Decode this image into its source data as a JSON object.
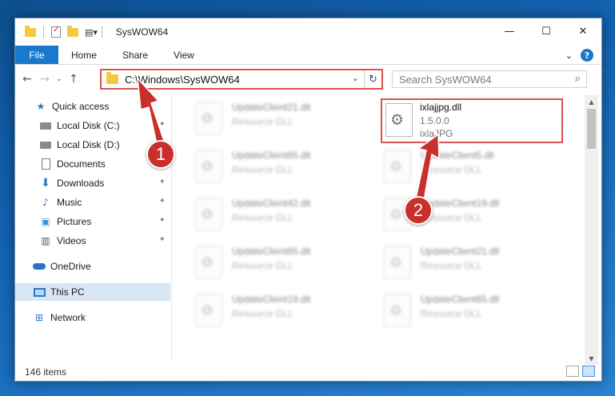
{
  "window": {
    "title": "SysWOW64",
    "controls": {
      "minimize": "—",
      "maximize": "☐",
      "close": "✕"
    }
  },
  "ribbon": {
    "tabs": [
      "File",
      "Home",
      "Share",
      "View"
    ],
    "help": "?",
    "expand": "⌄"
  },
  "nav": {
    "back": "←",
    "forward": "→",
    "recent": "⌄",
    "up": "↑",
    "address": "C:\\Windows\\SysWOW64",
    "address_dropdown": "⌄",
    "refresh": "↻",
    "search_placeholder": "Search SysWOW64",
    "search_icon": "⌕"
  },
  "sidebar": {
    "items": [
      {
        "label": "Quick access",
        "icon": "star-icon",
        "pinned": false
      },
      {
        "label": "Local Disk (C:)",
        "icon": "disk-icon",
        "pinned": true
      },
      {
        "label": "Local Disk (D:)",
        "icon": "disk-icon",
        "pinned": false
      },
      {
        "label": "Documents",
        "icon": "document-icon",
        "pinned": true
      },
      {
        "label": "Downloads",
        "icon": "download-icon",
        "pinned": true
      },
      {
        "label": "Music",
        "icon": "music-icon",
        "pinned": true
      },
      {
        "label": "Pictures",
        "icon": "pictures-icon",
        "pinned": true
      },
      {
        "label": "Videos",
        "icon": "videos-icon",
        "pinned": true
      },
      {
        "label": "OneDrive",
        "icon": "cloud-icon",
        "pinned": false
      },
      {
        "label": "This PC",
        "icon": "pc-icon",
        "pinned": false,
        "selected": true
      },
      {
        "label": "Network",
        "icon": "network-icon",
        "pinned": false
      }
    ],
    "pin_glyph": "📌"
  },
  "files": {
    "left_column": [
      {
        "name": "UpdateClient21.dll",
        "type": "Resource DLL"
      },
      {
        "name": "UpdateClient65.dll",
        "type": "Resource DLL"
      },
      {
        "name": "UpdateClient42.dll",
        "type": "Resource DLL"
      },
      {
        "name": "UpdateClient65.dll",
        "type": "Resource DLL"
      },
      {
        "name": "UpdateClient19.dll",
        "type": "Resource DLL"
      }
    ],
    "right_column": [
      {
        "name": "UpdateClient5.dll",
        "type": "Resource DLL"
      },
      {
        "name": "UpdateClient19.dll",
        "type": "Resource DLL"
      },
      {
        "name": "UpdateClient21.dll",
        "type": "Resource DLL"
      },
      {
        "name": "UpdateClient65.dll",
        "type": "Resource DLL"
      }
    ],
    "highlighted": {
      "name": "ixlajjpg.dll",
      "version": "1.5.0.0",
      "description": "ixlaJPG"
    }
  },
  "status": {
    "item_count": "146 items"
  },
  "annotations": {
    "step1": "1",
    "step2": "2",
    "color": "#c9302c"
  }
}
